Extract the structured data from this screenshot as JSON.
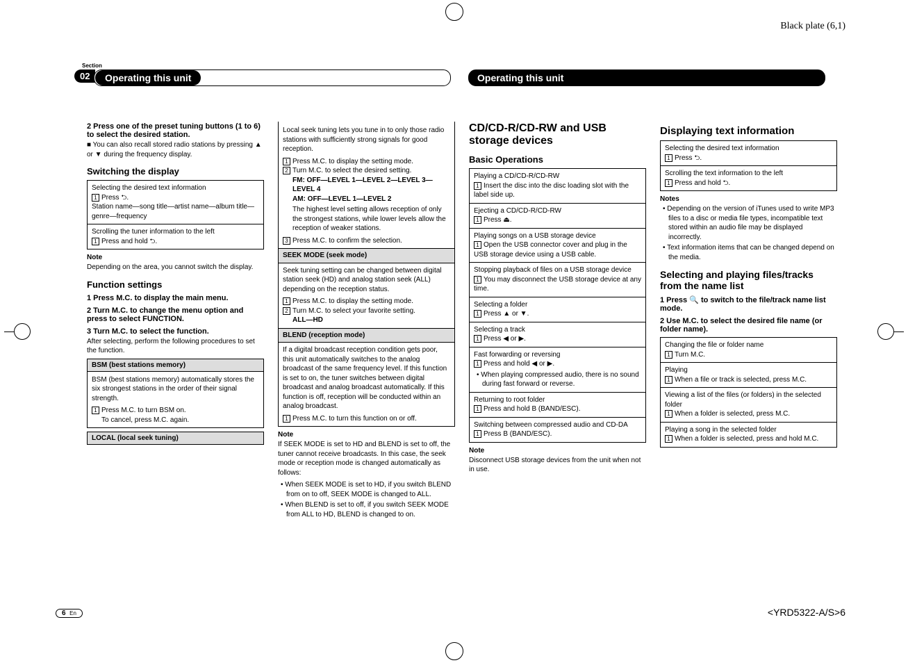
{
  "header": {
    "blackplate": "Black plate (6,1)",
    "section_label": "Section",
    "section_num": "02",
    "chapter_left": "Operating this unit",
    "chapter_right": "Operating this unit"
  },
  "col1": {
    "step2": "2   Press one of the preset tuning buttons (1 to 6) to select the desired station.",
    "step2_note": "■  You can also recall stored radio stations by pressing ▲ or ▼ during the frequency display.",
    "switching_h": "Switching the display",
    "box1_l1": "Selecting the desired text information",
    "box1_l2a": "Press ⮌.",
    "box1_l3": "Station name—song title—artist name—album title—genre—frequency",
    "box1_l4": "Scrolling the tuner information to the left",
    "box1_l5a": "Press and hold ⮌.",
    "notehead": "Note",
    "note_p": "Depending on the area, you cannot switch the display.",
    "func_h": "Function settings",
    "fs1": "1   Press M.C. to display the main menu.",
    "fs2": "2   Turn M.C. to change the menu option and press to select FUNCTION.",
    "fs3": "3   Turn M.C. to select the function.",
    "fs3_p": "After selecting, perform the following procedures to set the function.",
    "bsm_header": "BSM (best stations memory)",
    "bsm_p": "BSM (best stations memory) automatically stores the six strongest stations in the order of their signal strength.",
    "bsm_s1": "Press M.C. to turn BSM on.",
    "bsm_s2": "To cancel, press M.C. again.",
    "local_header": "LOCAL (local seek tuning)"
  },
  "col2": {
    "local_p": "Local seek tuning lets you tune in to only those radio stations with sufficiently strong signals for good reception.",
    "local_s1": "Press M.C. to display the setting mode.",
    "local_s2": "Turn M.C. to select the desired setting.",
    "local_fm": "FM: OFF—LEVEL 1—LEVEL 2—LEVEL 3—LEVEL 4",
    "local_am": "AM: OFF—LEVEL 1—LEVEL 2",
    "local_p2": "The highest level setting allows reception of only the strongest stations, while lower levels allow the reception of weaker stations.",
    "local_s3": "Press M.C. to confirm the selection.",
    "seek_header": "SEEK MODE (seek mode)",
    "seek_p": "Seek tuning setting can be changed between digital station seek (HD) and analog station seek (ALL) depending on the reception status.",
    "seek_s1": "Press M.C. to display the setting mode.",
    "seek_s2": "Turn M.C. to select your favorite setting.",
    "seek_opt": "ALL—HD",
    "blend_header": "BLEND (reception mode)",
    "blend_p": "If a digital broadcast reception condition gets poor, this unit automatically switches to the analog broadcast of the same frequency level. If this function is set to on, the tuner switches between digital broadcast and analog broadcast automatically. If this function is off, reception will be conducted within an analog broadcast.",
    "blend_s1": "Press M.C. to turn this function on or off.",
    "notehead": "Note",
    "note_p1": "If SEEK MODE is set to HD and BLEND is set to off, the tuner cannot receive broadcasts. In this case, the seek mode or reception mode is changed automatically as follows:",
    "note_b1": "When SEEK MODE is set to HD, if you switch BLEND from on to off, SEEK MODE is changed to ALL.",
    "note_b2": "When BLEND is set to off, if you switch SEEK MODE from ALL to HD, BLEND is changed to on."
  },
  "col3": {
    "title": "CD/CD-R/CD-RW and USB storage devices",
    "basic_h": "Basic Operations",
    "b1": "Playing a CD/CD-R/CD-RW",
    "b1s": "Insert the disc into the disc loading slot with the label side up.",
    "b2": "Ejecting a CD/CD-R/CD-RW",
    "b2s": "Press ⏏.",
    "b3": "Playing songs on a USB storage device",
    "b3s": "Open the USB connector cover and plug in the USB storage device using a USB cable.",
    "b4": "Stopping playback of files on a USB storage device",
    "b4s": "You may disconnect the USB storage device at any time.",
    "b5": "Selecting a folder",
    "b5s": "Press ▲ or ▼.",
    "b6": "Selecting a track",
    "b6s": "Press ◀ or ▶.",
    "b7": "Fast forwarding or reversing",
    "b7s": "Press and hold ◀ or ▶.",
    "b7b": "When playing compressed audio, there is no sound during fast forward or reverse.",
    "b8": "Returning to root folder",
    "b8s": "Press and hold B (BAND/ESC).",
    "b9": "Switching between compressed audio and CD-DA",
    "b9s": "Press B (BAND/ESC).",
    "notehead": "Note",
    "note_p": "Disconnect USB storage devices from the unit when not in use."
  },
  "col4": {
    "disp_h": "Displaying text information",
    "box1_l1": "Selecting the desired text information",
    "box1_l2": "Press ⮌.",
    "box1_l3": "Scrolling the text information to the left",
    "box1_l4": "Press and hold ⮌.",
    "noteshead": "Notes",
    "nb1": "Depending on the version of iTunes used to write MP3 files to a disc or media file types, incompatible text stored within an audio file may be displayed incorrectly.",
    "nb2": "Text information items that can be changed depend on the media.",
    "sel_h": "Selecting and playing files/tracks from the name list",
    "s1": "1   Press 🔍 to switch to the file/track name list mode.",
    "s2": "2   Use M.C. to select the desired file name (or folder name).",
    "bx1": "Changing the file or folder name",
    "bx1s": "Turn M.C.",
    "bx2": "Playing",
    "bx2s": "When a file or track is selected, press M.C.",
    "bx3": "Viewing a list of the files (or folders) in the selected folder",
    "bx3s": "When a folder is selected, press M.C.",
    "bx4": "Playing a song in the selected folder",
    "bx4s": "When a folder is selected, press and hold M.C."
  },
  "footer": {
    "pagenum": "6",
    "lang": "En",
    "doccode": "<YRD5322-A/S>6"
  }
}
